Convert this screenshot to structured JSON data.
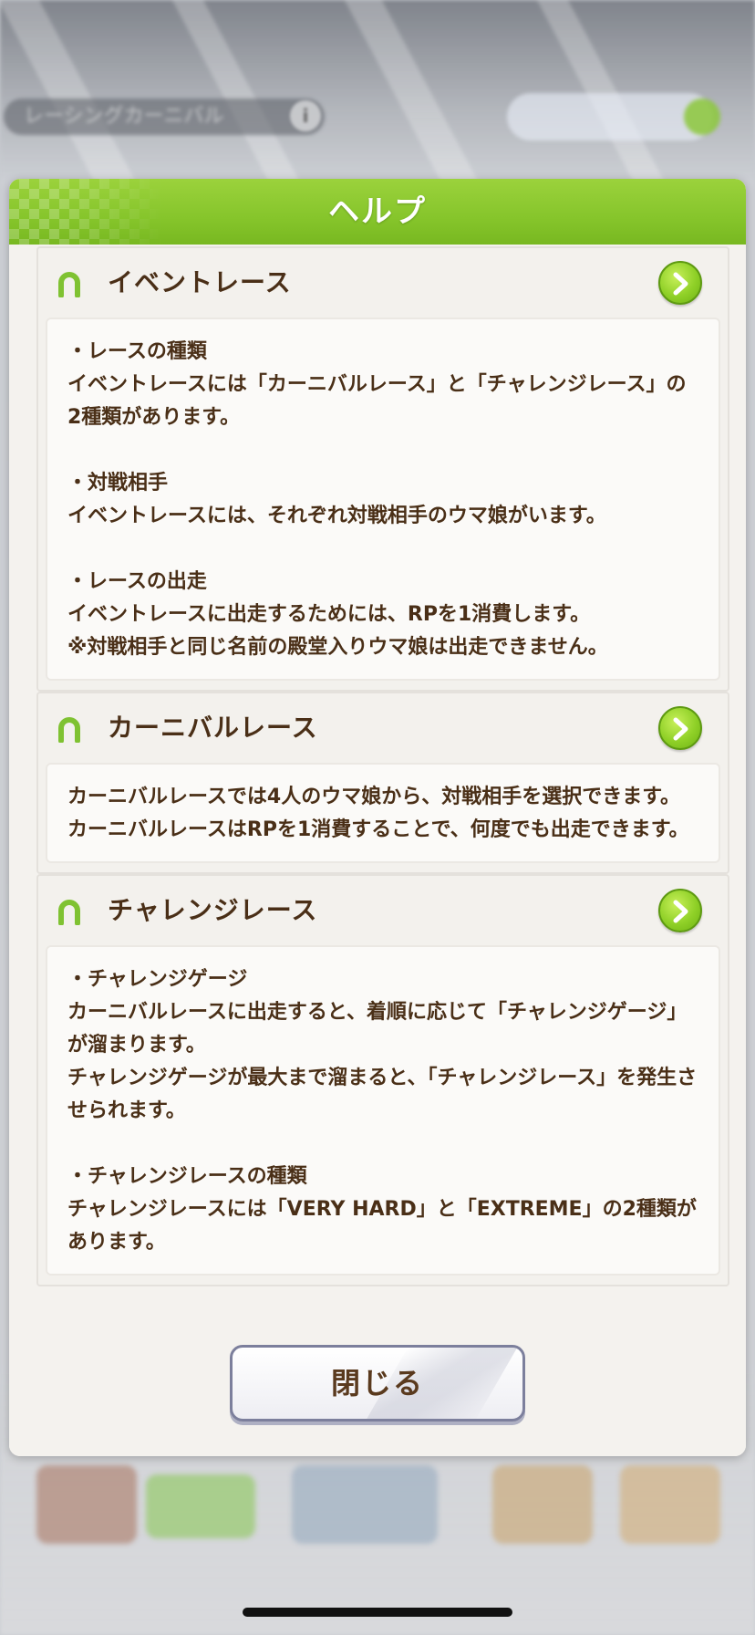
{
  "background": {
    "title_pill": "レーシングカーニバル",
    "info_icon": "i"
  },
  "modal": {
    "title": "ヘルプ",
    "sections": [
      {
        "title": "イベントレース",
        "body": "・レースの種類\nイベントレースには「カーニバルレース」と「チャレンジレース」の2種類があります。\n\n・対戦相手\nイベントレースには、それぞれ対戦相手のウマ娘がいます。\n\n・レースの出走\nイベントレースに出走するためには、RPを1消費します。\n※対戦相手と同じ名前の殿堂入りウマ娘は出走できません。"
      },
      {
        "title": "カーニバルレース",
        "body": "カーニバルレースでは4人のウマ娘から、対戦相手を選択できます。\nカーニバルレースはRPを1消費することで、何度でも出走できます。"
      },
      {
        "title": "チャレンジレース",
        "body": "・チャレンジゲージ\nカーニバルレースに出走すると、着順に応じて「チャレンジゲージ」が溜まります。\nチャレンジゲージが最大まで溜まると、「チャレンジレース」を発生させられます。\n\n・チャレンジレースの種類\nチャレンジレースには「VERY HARD」と「EXTREME」の2種類があります。"
      }
    ],
    "close_label": "閉じる"
  },
  "colors": {
    "accent_green": "#86c52b",
    "text_brown": "#4a2f17",
    "button_border": "#7c7f9c"
  }
}
